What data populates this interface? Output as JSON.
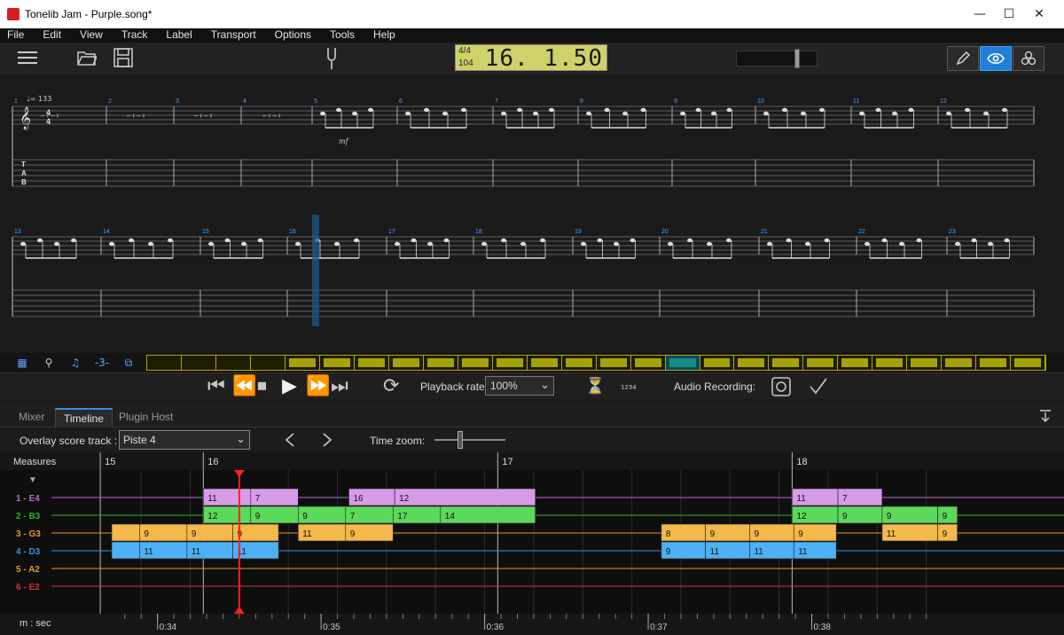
{
  "window": {
    "title": "Tonelib Jam - Purple.song*",
    "minimize": "—",
    "maximize": "☐",
    "close": "✕"
  },
  "menu": [
    "File",
    "Edit",
    "View",
    "Track",
    "Label",
    "Transport",
    "Options",
    "Tools",
    "Help"
  ],
  "lcd": {
    "time_signature": "4/4",
    "tempo": "104",
    "position": "16. 1.50"
  },
  "volume": {
    "level": 0.75
  },
  "playback_rate": {
    "label": "Playback rate:",
    "value": "100%"
  },
  "audio_recording": {
    "label": "Audio Recording:"
  },
  "tabs": [
    {
      "label": "Mixer",
      "active": false
    },
    {
      "label": "Timeline",
      "active": true
    },
    {
      "label": "Plugin Host",
      "active": false
    }
  ],
  "overlay": {
    "label": "Overlay score track :",
    "value": "Piste 4"
  },
  "time_zoom": {
    "label": "Time zoom:",
    "level": 0.35
  },
  "minitrack": {
    "tools": [
      "grid-icon",
      "search-icon",
      "note-icon",
      "triplet-icon",
      "loop-icon"
    ],
    "triplet_label": "-3-",
    "measure_count": 26,
    "filled_from": 4,
    "current": 15
  },
  "score": {
    "tempo_mark": "♩= 133",
    "row1_measures": [
      "1",
      "2",
      "3",
      "4",
      "5",
      "6",
      "7",
      "8",
      "9",
      "10",
      "11",
      "12"
    ],
    "row2_measures": [
      "13",
      "14",
      "15",
      "16",
      "17",
      "18",
      "19",
      "20",
      "21",
      "22",
      "23"
    ],
    "dynamic": "mf",
    "tab_clef": [
      "T",
      "A",
      "B"
    ]
  },
  "timeline": {
    "measures_label": "Measures",
    "measures": [
      {
        "n": "15",
        "t": 33.65
      },
      {
        "n": "16",
        "t": 34.28
      },
      {
        "n": "17",
        "t": 36.08
      },
      {
        "n": "18",
        "t": 37.88
      }
    ],
    "time_label": "m : sec",
    "time_ticks": [
      "0:34",
      "0:35",
      "0:36",
      "0:37",
      "0:38"
    ],
    "time_range": [
      33.72,
      38.55
    ],
    "playhead": 34.5,
    "strings": [
      {
        "name": "1 - E4",
        "color": "#b46fd0"
      },
      {
        "name": "2 - B3",
        "color": "#2fb03a"
      },
      {
        "name": "3 - G3",
        "color": "#e09b2a"
      },
      {
        "name": "4 - D3",
        "color": "#3a8ee0"
      },
      {
        "name": "5 - A2",
        "color": "#d8a22a"
      },
      {
        "name": "6 - E2",
        "color": "#d83030"
      }
    ],
    "notes": [
      {
        "s": 0,
        "t": 34.28,
        "d": 0.29,
        "f": "11"
      },
      {
        "s": 0,
        "t": 34.57,
        "d": 0.29,
        "f": "7"
      },
      {
        "s": 0,
        "t": 35.17,
        "d": 0.28,
        "f": "16"
      },
      {
        "s": 0,
        "t": 35.45,
        "d": 0.86,
        "f": "12"
      },
      {
        "s": 0,
        "t": 37.88,
        "d": 0.28,
        "f": "11"
      },
      {
        "s": 0,
        "t": 38.16,
        "d": 0.27,
        "f": "7"
      },
      {
        "s": 1,
        "t": 34.28,
        "d": 0.29,
        "f": "12"
      },
      {
        "s": 1,
        "t": 34.57,
        "d": 0.29,
        "f": "9"
      },
      {
        "s": 1,
        "t": 34.86,
        "d": 0.29,
        "f": "9"
      },
      {
        "s": 1,
        "t": 35.15,
        "d": 0.29,
        "f": "7"
      },
      {
        "s": 1,
        "t": 35.44,
        "d": 0.29,
        "f": "17"
      },
      {
        "s": 1,
        "t": 35.73,
        "d": 0.58,
        "f": "14"
      },
      {
        "s": 1,
        "t": 37.88,
        "d": 0.28,
        "f": "12"
      },
      {
        "s": 1,
        "t": 38.16,
        "d": 0.27,
        "f": "9"
      },
      {
        "s": 1,
        "t": 38.43,
        "d": 0.34,
        "f": "9"
      },
      {
        "s": 1,
        "t": 38.77,
        "d": 0.12,
        "f": "9"
      },
      {
        "s": 2,
        "t": 33.72,
        "d": 0.17,
        "f": ""
      },
      {
        "s": 2,
        "t": 33.89,
        "d": 0.29,
        "f": "9"
      },
      {
        "s": 2,
        "t": 34.18,
        "d": 0.28,
        "f": "9"
      },
      {
        "s": 2,
        "t": 34.46,
        "d": 0.28,
        "f": "9"
      },
      {
        "s": 2,
        "t": 34.86,
        "d": 0.29,
        "f": "11"
      },
      {
        "s": 2,
        "t": 35.15,
        "d": 0.29,
        "f": "9"
      },
      {
        "s": 2,
        "t": 37.08,
        "d": 0.27,
        "f": "8"
      },
      {
        "s": 2,
        "t": 37.35,
        "d": 0.27,
        "f": "9"
      },
      {
        "s": 2,
        "t": 37.62,
        "d": 0.27,
        "f": "9"
      },
      {
        "s": 2,
        "t": 37.89,
        "d": 0.26,
        "f": "9"
      },
      {
        "s": 2,
        "t": 38.43,
        "d": 0.34,
        "f": "11"
      },
      {
        "s": 2,
        "t": 38.77,
        "d": 0.12,
        "f": "9"
      },
      {
        "s": 3,
        "t": 33.72,
        "d": 0.17,
        "f": ""
      },
      {
        "s": 3,
        "t": 33.89,
        "d": 0.29,
        "f": "11"
      },
      {
        "s": 3,
        "t": 34.18,
        "d": 0.28,
        "f": "11"
      },
      {
        "s": 3,
        "t": 34.46,
        "d": 0.28,
        "f": "11"
      },
      {
        "s": 3,
        "t": 37.08,
        "d": 0.27,
        "f": "9"
      },
      {
        "s": 3,
        "t": 37.35,
        "d": 0.27,
        "f": "11"
      },
      {
        "s": 3,
        "t": 37.62,
        "d": 0.27,
        "f": "11"
      },
      {
        "s": 3,
        "t": 37.89,
        "d": 0.26,
        "f": "11"
      }
    ]
  },
  "colors": {
    "accent": "#3a8dde",
    "lcd": "#cfd26a",
    "playhead": "#ff2020",
    "measure_fill": "#a5a20a"
  }
}
